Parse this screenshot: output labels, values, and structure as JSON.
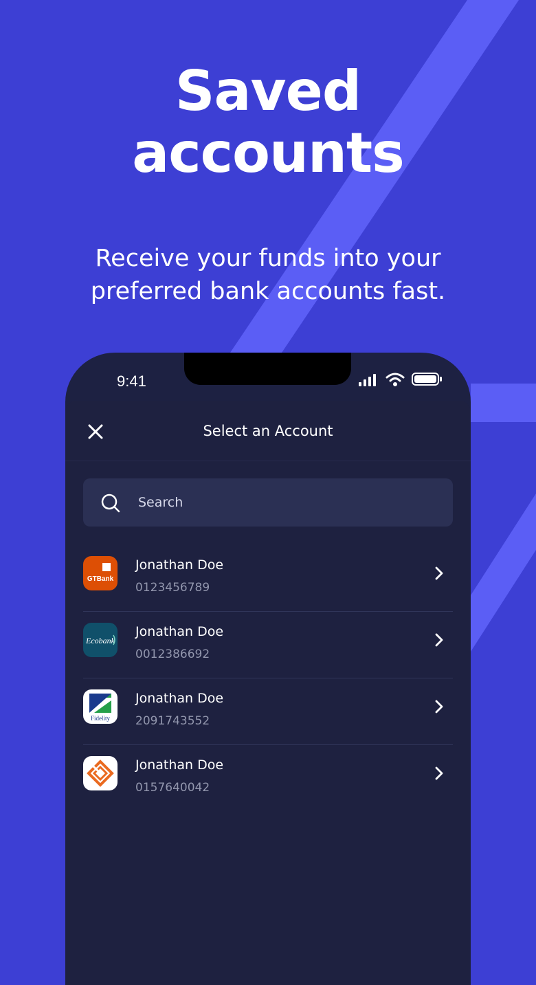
{
  "hero": {
    "title_line1": "Saved",
    "title_line2": "accounts",
    "subtitle_line1": "Receive your funds into your",
    "subtitle_line2": "preferred bank accounts fast."
  },
  "status_bar": {
    "time": "9:41",
    "icons": [
      "cellular-signal-icon",
      "wifi-icon",
      "battery-icon"
    ]
  },
  "modal": {
    "title": "Select an Account",
    "close_icon": "close-icon"
  },
  "search": {
    "placeholder": "Search",
    "icon": "search-icon"
  },
  "accounts": [
    {
      "name": "Jonathan Doe",
      "number": "0123456789",
      "bank": "GTBank",
      "logo_label": "GTBank",
      "logo_color": "#dd4f05"
    },
    {
      "name": "Jonathan Doe",
      "number": "0012386692",
      "bank": "Ecobank",
      "logo_label": "Ecobank",
      "logo_color": "#10506a"
    },
    {
      "name": "Jonathan Doe",
      "number": "2091743552",
      "bank": "Fidelity",
      "logo_label": "Fidelity",
      "logo_color": "#ffffff"
    },
    {
      "name": "Jonathan Doe",
      "number": "0157640042",
      "bank": "Unknown",
      "logo_label": "",
      "logo_color": "#ffffff"
    }
  ],
  "colors": {
    "background": "#3d3fd4",
    "stripe": "#5b5ef5",
    "phone_body": "#1d2142",
    "search_field": "#2b3054",
    "secondary_text": "#9296ad"
  }
}
